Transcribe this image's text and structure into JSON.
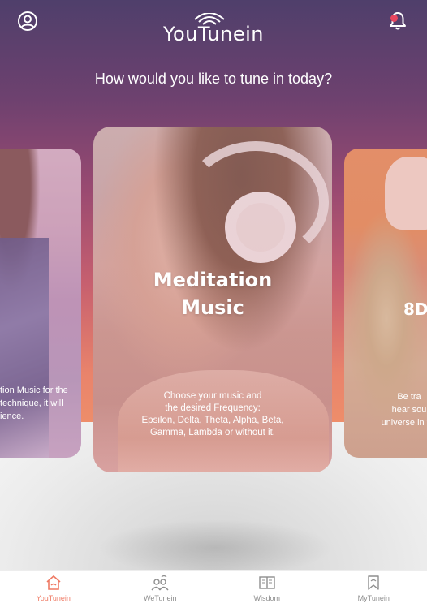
{
  "header": {
    "logo_text": "YouTunein",
    "tagline": "How would you like to tune in today?",
    "profile_icon": "profile-icon",
    "notification_icon": "bell-icon",
    "notification_dot_color": "#e8465f"
  },
  "carousel": {
    "left_card": {
      "text_lines": [
        "tion Music for the",
        "technique, it will",
        "",
        "ience."
      ]
    },
    "center_card": {
      "title_line1": "Meditation",
      "title_line2": "Music",
      "desc_line1": "Choose your music and",
      "desc_line2": "the desired Frequency:",
      "desc_line3": "Epsilon, Delta, Theta, Alpha, Beta,",
      "desc_line4": "Gamma, Lambda or without it."
    },
    "right_card": {
      "title": "8D",
      "text_line1": "Be tra",
      "text_line2": "hear sou",
      "text_line3": "universe in tra"
    }
  },
  "bottom_nav": {
    "items": [
      {
        "label": "YouTunein",
        "icon": "home-icon",
        "active": true
      },
      {
        "label": "WeTunein",
        "icon": "community-icon",
        "active": false
      },
      {
        "label": "Wisdom",
        "icon": "book-icon",
        "active": false
      },
      {
        "label": "MyTunein",
        "icon": "bookmark-icon",
        "active": false
      }
    ],
    "active_color": "#ef7a64",
    "inactive_color": "#8e8e8e"
  },
  "colors": {
    "gradient_top": "#4f3f6b",
    "gradient_bottom": "#f1946a"
  }
}
